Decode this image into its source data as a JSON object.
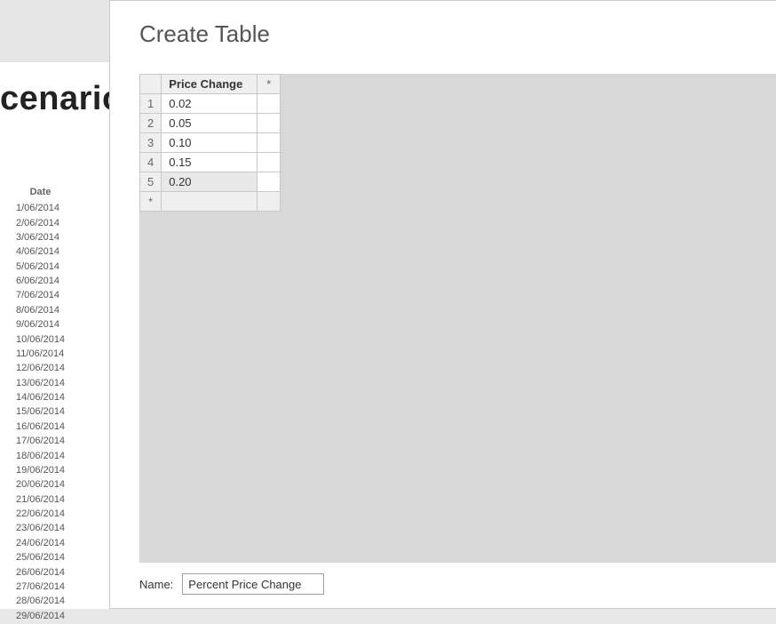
{
  "background": {
    "heading": "cenario",
    "date_header": "Date",
    "dates": [
      "1/06/2014",
      "2/06/2014",
      "3/06/2014",
      "4/06/2014",
      "5/06/2014",
      "6/06/2014",
      "7/06/2014",
      "8/06/2014",
      "9/06/2014",
      "10/06/2014",
      "11/06/2014",
      "12/06/2014",
      "13/06/2014",
      "14/06/2014",
      "15/06/2014",
      "16/06/2014",
      "17/06/2014",
      "18/06/2014",
      "19/06/2014",
      "20/06/2014",
      "21/06/2014",
      "22/06/2014",
      "23/06/2014",
      "24/06/2014",
      "25/06/2014",
      "26/06/2014",
      "27/06/2014",
      "28/06/2014",
      "29/06/2014"
    ]
  },
  "dialog": {
    "title": "Create Table",
    "column_header": "Price Change",
    "add_column_marker": "*",
    "new_row_marker": "*",
    "rows": [
      {
        "n": "1",
        "value": "0.02"
      },
      {
        "n": "2",
        "value": "0.05"
      },
      {
        "n": "3",
        "value": "0.10"
      },
      {
        "n": "4",
        "value": "0.15"
      },
      {
        "n": "5",
        "value": "0.20"
      }
    ],
    "selected_row_index": 4,
    "name_label": "Name:",
    "name_value": "Percent Price Change"
  }
}
